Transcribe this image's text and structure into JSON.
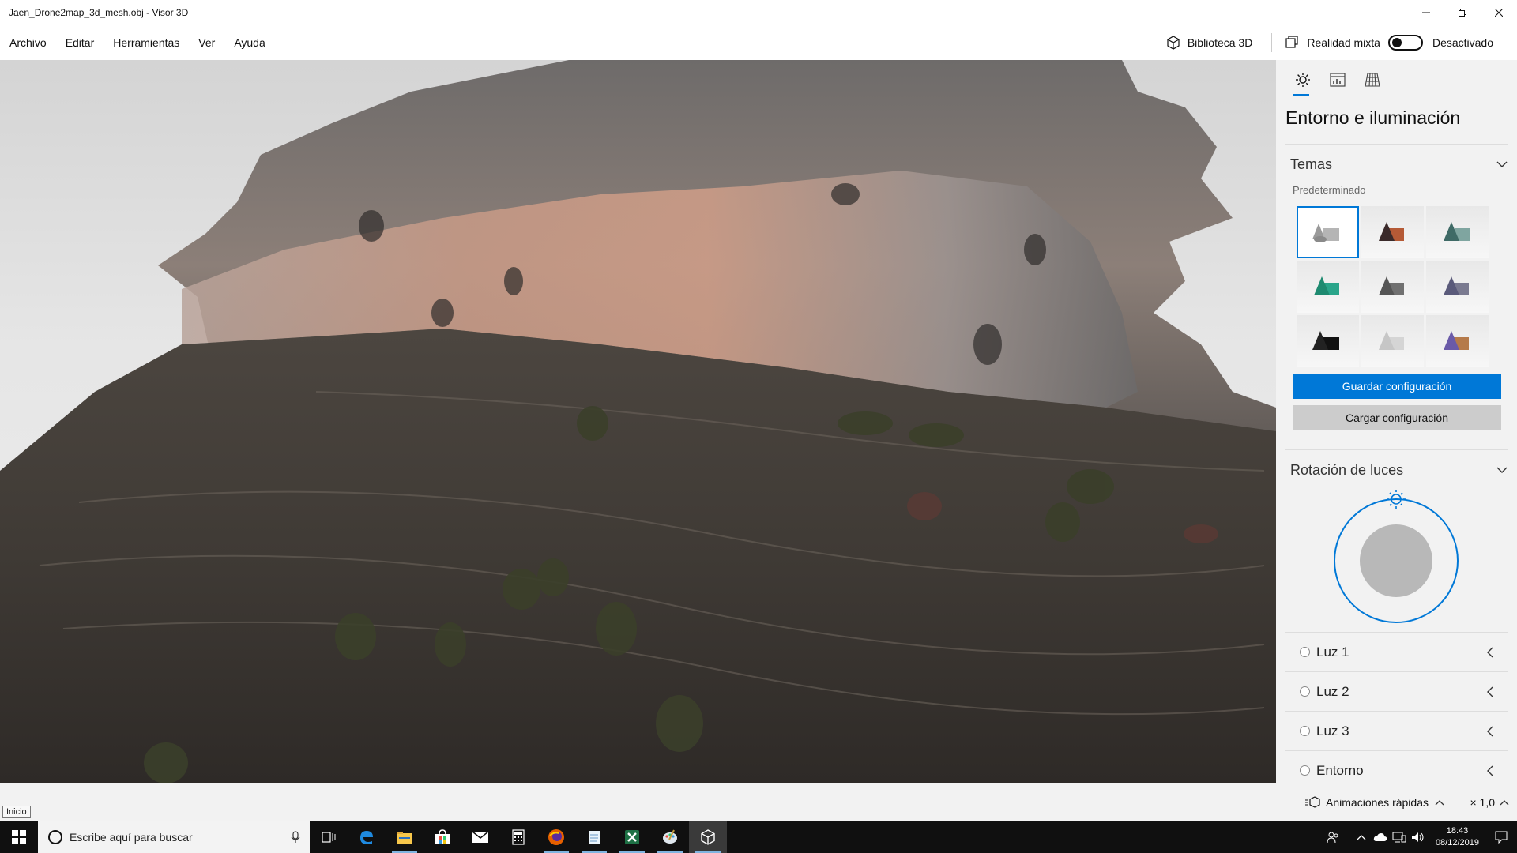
{
  "window": {
    "title": "Jaen_Drone2map_3d_mesh.obj - Visor 3D"
  },
  "menu": {
    "items": [
      "Archivo",
      "Editar",
      "Herramientas",
      "Ver",
      "Ayuda"
    ]
  },
  "toolbar": {
    "library_label": "Biblioteca 3D",
    "mixed_reality_label": "Realidad mixta",
    "mixed_reality_state": "Desactivado"
  },
  "panel": {
    "title": "Entorno e iluminación",
    "themes": {
      "label": "Temas",
      "sublabel": "Predeterminado",
      "selected_index": 0
    },
    "save_button": "Guardar configuración",
    "load_button": "Cargar configuración",
    "light_rotation": {
      "label": "Rotación de luces"
    },
    "lights": [
      "Luz 1",
      "Luz 2",
      "Luz 3",
      "Entorno"
    ]
  },
  "statusbar": {
    "tooltip": "Inicio",
    "animations_label": "Animaciones rápidas",
    "speed_label": "× 1,0"
  },
  "taskbar": {
    "search_placeholder": "Escribe aquí para buscar",
    "time": "18:43",
    "date": "08/12/2019"
  },
  "colors": {
    "accent": "#0078d7",
    "panel_bg": "#f2f2f2",
    "taskbar_bg": "#101010"
  },
  "icons": {
    "panel_tabs": [
      "sun-icon",
      "stats-icon",
      "grid-icon"
    ],
    "taskbar_apps": [
      "task-view-icon",
      "edge-icon",
      "file-explorer-icon",
      "store-icon",
      "mail-icon",
      "calculator-icon",
      "firefox-icon",
      "notepad-icon",
      "excel-icon",
      "paint-icon",
      "3d-viewer-icon"
    ]
  }
}
